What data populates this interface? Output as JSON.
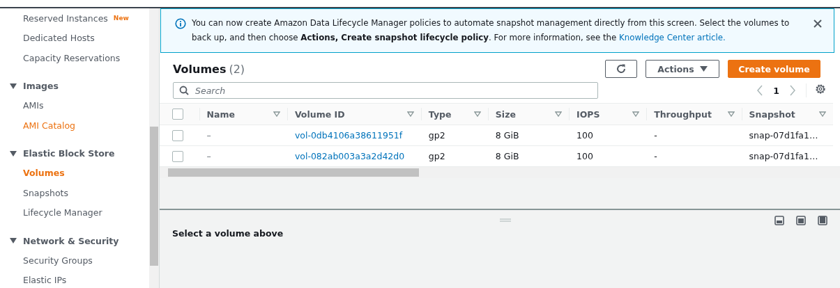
{
  "sidebar": {
    "sections": [
      {
        "items": [
          {
            "label": "Reserved Instances",
            "badge": "New",
            "selected": false,
            "highlighted": false
          },
          {
            "label": "Dedicated Hosts",
            "selected": false,
            "highlighted": false
          },
          {
            "label": "Capacity Reservations",
            "selected": false,
            "highlighted": false
          }
        ]
      },
      {
        "title": "Images",
        "expanded": true,
        "items": [
          {
            "label": "AMIs",
            "selected": false,
            "highlighted": false
          },
          {
            "label": "AMI Catalog",
            "selected": false,
            "highlighted": true
          }
        ]
      },
      {
        "title": "Elastic Block Store",
        "expanded": true,
        "items": [
          {
            "label": "Volumes",
            "selected": true,
            "highlighted": true
          },
          {
            "label": "Snapshots",
            "selected": false,
            "highlighted": false
          },
          {
            "label": "Lifecycle Manager",
            "selected": false,
            "highlighted": false
          }
        ]
      },
      {
        "title": "Network & Security",
        "expanded": true,
        "items": [
          {
            "label": "Security Groups",
            "selected": false,
            "highlighted": false
          },
          {
            "label": "Elastic IPs",
            "selected": false,
            "highlighted": false
          }
        ]
      }
    ]
  },
  "banner": {
    "text_before": "You can now create Amazon Data Lifecycle Manager policies to automate snapshot management directly from this screen. Select the volumes to back up, and then choose **Actions, Create snapshot lifecycle policy**. For more information, see the",
    "link": "Knowledge Center article."
  },
  "volumes": {
    "title": "Volumes",
    "count": "(2)",
    "actions_label": "Actions",
    "create_label": "Create volume",
    "search_placeholder": "Search",
    "page": "1",
    "select_all_checked": false,
    "columns": [
      "Name",
      "Volume ID",
      "Type",
      "Size",
      "IOPS",
      "Throughput",
      "Snapshot"
    ],
    "rows": [
      {
        "checked": false,
        "cells": [
          "–",
          "vol-0db4106a38611951f",
          "gp2",
          "8 GiB",
          "100",
          "-",
          "snap-07d1fa1…"
        ]
      },
      {
        "checked": false,
        "cells": [
          "–",
          "vol-082ab003a3a2d42d0",
          "gp2",
          "8 GiB",
          "100",
          "-",
          "snap-07d1fa1…"
        ]
      }
    ]
  },
  "details": {
    "message": "Select a volume above"
  }
}
